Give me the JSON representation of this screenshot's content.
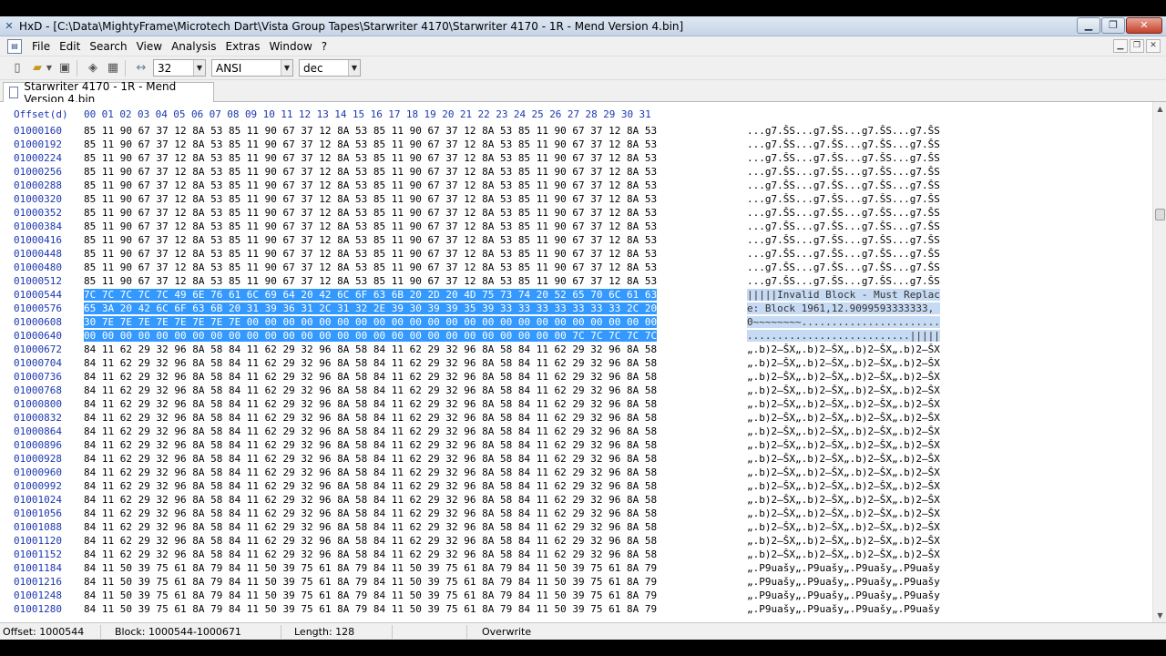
{
  "window": {
    "title": "HxD - [C:\\Data\\MightyFrame\\Microtech Dart\\Vista Group Tapes\\Starwriter 4170\\Starwriter 4170 - 1R - Mend Version 4.bin]",
    "minimize": "▁",
    "maximize": "❐",
    "close": "✕"
  },
  "menu": [
    "File",
    "Edit",
    "Search",
    "View",
    "Analysis",
    "Extras",
    "Window",
    "?"
  ],
  "toolbar": {
    "bytes_per_row": "32",
    "charset": "ANSI",
    "offset_base": "dec"
  },
  "tab": {
    "label": "Starwriter 4170 - 1R - Mend Version 4.bin"
  },
  "editor": {
    "offset_header": "Offset(d)",
    "columns": [
      "00",
      "01",
      "02",
      "03",
      "04",
      "05",
      "06",
      "07",
      "08",
      "09",
      "10",
      "11",
      "12",
      "13",
      "14",
      "15",
      "16",
      "17",
      "18",
      "19",
      "20",
      "21",
      "22",
      "23",
      "24",
      "25",
      "26",
      "27",
      "28",
      "29",
      "30",
      "31"
    ],
    "rows": [
      {
        "offset": "01000160",
        "hex": "85 11 90 67 37 12 8A 53 85 11 90 67 37 12 8A 53 85 11 90 67 37 12 8A 53 85 11 90 67 37 12 8A 53",
        "text": "...g7.ŠS...g7.ŠS...g7.ŠS...g7.ŠS",
        "selected": false
      },
      {
        "offset": "01000192",
        "hex": "85 11 90 67 37 12 8A 53 85 11 90 67 37 12 8A 53 85 11 90 67 37 12 8A 53 85 11 90 67 37 12 8A 53",
        "text": "...g7.ŠS...g7.ŠS...g7.ŠS...g7.ŠS",
        "selected": false
      },
      {
        "offset": "01000224",
        "hex": "85 11 90 67 37 12 8A 53 85 11 90 67 37 12 8A 53 85 11 90 67 37 12 8A 53 85 11 90 67 37 12 8A 53",
        "text": "...g7.ŠS...g7.ŠS...g7.ŠS...g7.ŠS",
        "selected": false
      },
      {
        "offset": "01000256",
        "hex": "85 11 90 67 37 12 8A 53 85 11 90 67 37 12 8A 53 85 11 90 67 37 12 8A 53 85 11 90 67 37 12 8A 53",
        "text": "...g7.ŠS...g7.ŠS...g7.ŠS...g7.ŠS",
        "selected": false
      },
      {
        "offset": "01000288",
        "hex": "85 11 90 67 37 12 8A 53 85 11 90 67 37 12 8A 53 85 11 90 67 37 12 8A 53 85 11 90 67 37 12 8A 53",
        "text": "...g7.ŠS...g7.ŠS...g7.ŠS...g7.ŠS",
        "selected": false
      },
      {
        "offset": "01000320",
        "hex": "85 11 90 67 37 12 8A 53 85 11 90 67 37 12 8A 53 85 11 90 67 37 12 8A 53 85 11 90 67 37 12 8A 53",
        "text": "...g7.ŠS...g7.ŠS...g7.ŠS...g7.ŠS",
        "selected": false
      },
      {
        "offset": "01000352",
        "hex": "85 11 90 67 37 12 8A 53 85 11 90 67 37 12 8A 53 85 11 90 67 37 12 8A 53 85 11 90 67 37 12 8A 53",
        "text": "...g7.ŠS...g7.ŠS...g7.ŠS...g7.ŠS",
        "selected": false
      },
      {
        "offset": "01000384",
        "hex": "85 11 90 67 37 12 8A 53 85 11 90 67 37 12 8A 53 85 11 90 67 37 12 8A 53 85 11 90 67 37 12 8A 53",
        "text": "...g7.ŠS...g7.ŠS...g7.ŠS...g7.ŠS",
        "selected": false
      },
      {
        "offset": "01000416",
        "hex": "85 11 90 67 37 12 8A 53 85 11 90 67 37 12 8A 53 85 11 90 67 37 12 8A 53 85 11 90 67 37 12 8A 53",
        "text": "...g7.ŠS...g7.ŠS...g7.ŠS...g7.ŠS",
        "selected": false
      },
      {
        "offset": "01000448",
        "hex": "85 11 90 67 37 12 8A 53 85 11 90 67 37 12 8A 53 85 11 90 67 37 12 8A 53 85 11 90 67 37 12 8A 53",
        "text": "...g7.ŠS...g7.ŠS...g7.ŠS...g7.ŠS",
        "selected": false
      },
      {
        "offset": "01000480",
        "hex": "85 11 90 67 37 12 8A 53 85 11 90 67 37 12 8A 53 85 11 90 67 37 12 8A 53 85 11 90 67 37 12 8A 53",
        "text": "...g7.ŠS...g7.ŠS...g7.ŠS...g7.ŠS",
        "selected": false
      },
      {
        "offset": "01000512",
        "hex": "85 11 90 67 37 12 8A 53 85 11 90 67 37 12 8A 53 85 11 90 67 37 12 8A 53 85 11 90 67 37 12 8A 53",
        "text": "...g7.ŠS...g7.ŠS...g7.ŠS...g7.ŠS",
        "selected": false
      },
      {
        "offset": "01000544",
        "hex": "7C 7C 7C 7C 7C 49 6E 76 61 6C 69 64 20 42 6C 6F 63 6B 20 2D 20 4D 75 73 74 20 52 65 70 6C 61 63",
        "text": "|||||Invalid Block - Must Replac",
        "selected": true
      },
      {
        "offset": "01000576",
        "hex": "65 3A 20 42 6C 6F 63 6B 20 31 39 36 31 2C 31 32 2E 39 30 39 39 35 39 33 33 33 33 33 33 33 2C 20",
        "text": "e: Block 1961,12.9099593333333, ",
        "selected": true
      },
      {
        "offset": "01000608",
        "hex": "30 7E 7E 7E 7E 7E 7E 7E 7E 00 00 00 00 00 00 00 00 00 00 00 00 00 00 00 00 00 00 00 00 00 00 00",
        "text": "0~~~~~~~~.......................",
        "selected": true
      },
      {
        "offset": "01000640",
        "hex": "00 00 00 00 00 00 00 00 00 00 00 00 00 00 00 00 00 00 00 00 00 00 00 00 00 00 00 7C 7C 7C 7C 7C",
        "text": "...........................|||||",
        "selected": true
      },
      {
        "offset": "01000672",
        "hex": "84 11 62 29 32 96 8A 58 84 11 62 29 32 96 8A 58 84 11 62 29 32 96 8A 58 84 11 62 29 32 96 8A 58",
        "text": "„.b)2–ŠX„.b)2–ŠX„.b)2–ŠX„.b)2–ŠX",
        "selected": false
      },
      {
        "offset": "01000704",
        "hex": "84 11 62 29 32 96 8A 58 84 11 62 29 32 96 8A 58 84 11 62 29 32 96 8A 58 84 11 62 29 32 96 8A 58",
        "text": "„.b)2–ŠX„.b)2–ŠX„.b)2–ŠX„.b)2–ŠX",
        "selected": false
      },
      {
        "offset": "01000736",
        "hex": "84 11 62 29 32 96 8A 58 84 11 62 29 32 96 8A 58 84 11 62 29 32 96 8A 58 84 11 62 29 32 96 8A 58",
        "text": "„.b)2–ŠX„.b)2–ŠX„.b)2–ŠX„.b)2–ŠX",
        "selected": false
      },
      {
        "offset": "01000768",
        "hex": "84 11 62 29 32 96 8A 58 84 11 62 29 32 96 8A 58 84 11 62 29 32 96 8A 58 84 11 62 29 32 96 8A 58",
        "text": "„.b)2–ŠX„.b)2–ŠX„.b)2–ŠX„.b)2–ŠX",
        "selected": false
      },
      {
        "offset": "01000800",
        "hex": "84 11 62 29 32 96 8A 58 84 11 62 29 32 96 8A 58 84 11 62 29 32 96 8A 58 84 11 62 29 32 96 8A 58",
        "text": "„.b)2–ŠX„.b)2–ŠX„.b)2–ŠX„.b)2–ŠX",
        "selected": false
      },
      {
        "offset": "01000832",
        "hex": "84 11 62 29 32 96 8A 58 84 11 62 29 32 96 8A 58 84 11 62 29 32 96 8A 58 84 11 62 29 32 96 8A 58",
        "text": "„.b)2–ŠX„.b)2–ŠX„.b)2–ŠX„.b)2–ŠX",
        "selected": false
      },
      {
        "offset": "01000864",
        "hex": "84 11 62 29 32 96 8A 58 84 11 62 29 32 96 8A 58 84 11 62 29 32 96 8A 58 84 11 62 29 32 96 8A 58",
        "text": "„.b)2–ŠX„.b)2–ŠX„.b)2–ŠX„.b)2–ŠX",
        "selected": false
      },
      {
        "offset": "01000896",
        "hex": "84 11 62 29 32 96 8A 58 84 11 62 29 32 96 8A 58 84 11 62 29 32 96 8A 58 84 11 62 29 32 96 8A 58",
        "text": "„.b)2–ŠX„.b)2–ŠX„.b)2–ŠX„.b)2–ŠX",
        "selected": false
      },
      {
        "offset": "01000928",
        "hex": "84 11 62 29 32 96 8A 58 84 11 62 29 32 96 8A 58 84 11 62 29 32 96 8A 58 84 11 62 29 32 96 8A 58",
        "text": "„.b)2–ŠX„.b)2–ŠX„.b)2–ŠX„.b)2–ŠX",
        "selected": false
      },
      {
        "offset": "01000960",
        "hex": "84 11 62 29 32 96 8A 58 84 11 62 29 32 96 8A 58 84 11 62 29 32 96 8A 58 84 11 62 29 32 96 8A 58",
        "text": "„.b)2–ŠX„.b)2–ŠX„.b)2–ŠX„.b)2–ŠX",
        "selected": false
      },
      {
        "offset": "01000992",
        "hex": "84 11 62 29 32 96 8A 58 84 11 62 29 32 96 8A 58 84 11 62 29 32 96 8A 58 84 11 62 29 32 96 8A 58",
        "text": "„.b)2–ŠX„.b)2–ŠX„.b)2–ŠX„.b)2–ŠX",
        "selected": false
      },
      {
        "offset": "01001024",
        "hex": "84 11 62 29 32 96 8A 58 84 11 62 29 32 96 8A 58 84 11 62 29 32 96 8A 58 84 11 62 29 32 96 8A 58",
        "text": "„.b)2–ŠX„.b)2–ŠX„.b)2–ŠX„.b)2–ŠX",
        "selected": false
      },
      {
        "offset": "01001056",
        "hex": "84 11 62 29 32 96 8A 58 84 11 62 29 32 96 8A 58 84 11 62 29 32 96 8A 58 84 11 62 29 32 96 8A 58",
        "text": "„.b)2–ŠX„.b)2–ŠX„.b)2–ŠX„.b)2–ŠX",
        "selected": false
      },
      {
        "offset": "01001088",
        "hex": "84 11 62 29 32 96 8A 58 84 11 62 29 32 96 8A 58 84 11 62 29 32 96 8A 58 84 11 62 29 32 96 8A 58",
        "text": "„.b)2–ŠX„.b)2–ŠX„.b)2–ŠX„.b)2–ŠX",
        "selected": false
      },
      {
        "offset": "01001120",
        "hex": "84 11 62 29 32 96 8A 58 84 11 62 29 32 96 8A 58 84 11 62 29 32 96 8A 58 84 11 62 29 32 96 8A 58",
        "text": "„.b)2–ŠX„.b)2–ŠX„.b)2–ŠX„.b)2–ŠX",
        "selected": false
      },
      {
        "offset": "01001152",
        "hex": "84 11 62 29 32 96 8A 58 84 11 62 29 32 96 8A 58 84 11 62 29 32 96 8A 58 84 11 62 29 32 96 8A 58",
        "text": "„.b)2–ŠX„.b)2–ŠX„.b)2–ŠX„.b)2–ŠX",
        "selected": false
      },
      {
        "offset": "01001184",
        "hex": "84 11 50 39 75 61 8A 79 84 11 50 39 75 61 8A 79 84 11 50 39 75 61 8A 79 84 11 50 39 75 61 8A 79",
        "text": "„.P9uašy„.P9uašy„.P9uašy„.P9uašy",
        "selected": false
      },
      {
        "offset": "01001216",
        "hex": "84 11 50 39 75 61 8A 79 84 11 50 39 75 61 8A 79 84 11 50 39 75 61 8A 79 84 11 50 39 75 61 8A 79",
        "text": "„.P9uašy„.P9uašy„.P9uašy„.P9uašy",
        "selected": false
      },
      {
        "offset": "01001248",
        "hex": "84 11 50 39 75 61 8A 79 84 11 50 39 75 61 8A 79 84 11 50 39 75 61 8A 79 84 11 50 39 75 61 8A 79",
        "text": "„.P9uašy„.P9uašy„.P9uašy„.P9uašy",
        "selected": false
      },
      {
        "offset": "01001280",
        "hex": "84 11 50 39 75 61 8A 79 84 11 50 39 75 61 8A 79 84 11 50 39 75 61 8A 79 84 11 50 39 75 61 8A 79",
        "text": "„.P9uašy„.P9uašy„.P9uašy„.P9uašy",
        "selected": false
      }
    ]
  },
  "status": {
    "offset": "Offset: 1000544",
    "block": "Block: 1000544-1000671",
    "length": "Length: 128",
    "mode": "Overwrite"
  },
  "colors": {
    "offset_blue": "#1c37b0",
    "selection": "#3399ff",
    "text_selection": "#c6daf3"
  }
}
